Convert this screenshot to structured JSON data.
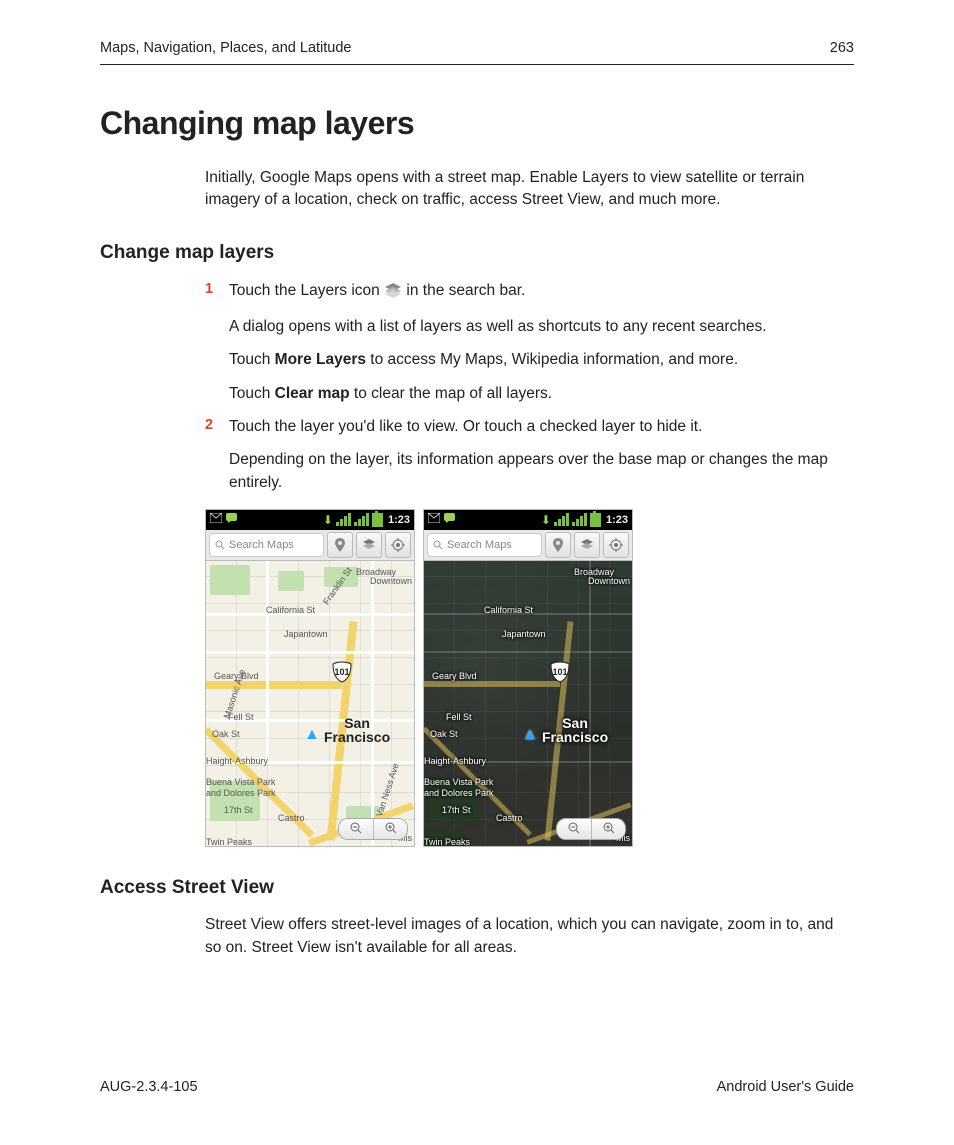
{
  "header": {
    "chapter": "Maps, Navigation, Places, and Latitude",
    "page": "263"
  },
  "title": "Changing map layers",
  "intro": "Initially, Google Maps opens with a street map. Enable Layers to view satellite or terrain imagery of a location, check on traffic, access Street View, and much more.",
  "section1": {
    "heading": "Change map layers",
    "step1": {
      "num": "1",
      "line_a": "Touch the Layers icon",
      "line_b": "in the search bar.",
      "p2": "A dialog opens with a list of layers as well as shortcuts to any recent searches.",
      "p3_a": "Touch ",
      "p3_bold": "More Layers",
      "p3_b": " to access My Maps, Wikipedia information, and more.",
      "p4_a": "Touch ",
      "p4_bold": "Clear map",
      "p4_b": " to clear the map of all layers."
    },
    "step2": {
      "num": "2",
      "p1": "Touch the layer you'd like to view. Or touch a checked layer to hide it.",
      "p2": "Depending on the layer, its information appears over the base map or changes the map entirely."
    }
  },
  "screenshots": {
    "clock": "1:23",
    "search_placeholder": "Search Maps",
    "hwy": "101",
    "city": "San\nFrancisco",
    "labels": {
      "broadway": "Broadway",
      "california": "California St",
      "japantown": "Japantown",
      "geary": "Geary Blvd",
      "fell": "Fell St",
      "oak": "Oak St",
      "haight": "Haight-Ashbury",
      "buena": "Buena Vista Park",
      "dolores": "and Dolores Park",
      "seventeen": "17th St",
      "castro": "Castro",
      "twin": "Twin Peaks",
      "franklin": "Franklin St",
      "vanness": "S Van Ness Ave",
      "downtown": "Downtown",
      "masonic": "Masonic Ave",
      "mis": "Mis"
    }
  },
  "section2": {
    "heading": "Access Street View",
    "p1": "Street View offers street-level images of a location, which you can navigate, zoom in to, and so on. Street View isn't available for all areas."
  },
  "footer": {
    "left": "AUG-2.3.4-105",
    "right": "Android User's Guide"
  }
}
